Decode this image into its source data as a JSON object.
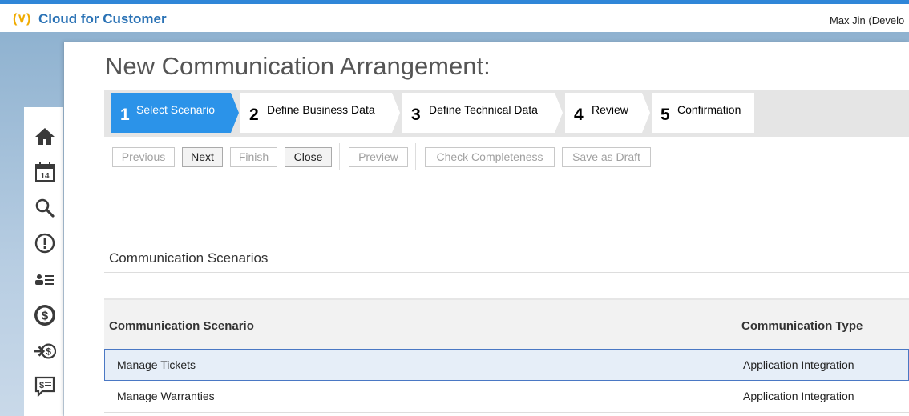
{
  "header": {
    "app_title": "Cloud for Customer",
    "user": "Max Jin (Develo",
    "logo_glyph": "(∨)"
  },
  "sidebar": {
    "items": [
      {
        "name": "home-icon"
      },
      {
        "name": "calendar-icon",
        "glyph": "14"
      },
      {
        "name": "search-icon"
      },
      {
        "name": "alert-icon"
      },
      {
        "name": "contacts-list-icon"
      },
      {
        "name": "dollar-icon"
      },
      {
        "name": "sales-transfer-icon"
      },
      {
        "name": "quote-icon"
      }
    ]
  },
  "page": {
    "title": "New Communication Arrangement:"
  },
  "steps": [
    {
      "num": "1",
      "label": "Select Scenario",
      "active": true
    },
    {
      "num": "2",
      "label": "Define Business Data",
      "active": false
    },
    {
      "num": "3",
      "label": "Define Technical Data",
      "active": false
    },
    {
      "num": "4",
      "label": "Review",
      "active": false
    },
    {
      "num": "5",
      "label": "Confirmation",
      "active": false
    }
  ],
  "toolbar": {
    "previous": "Previous",
    "next": "Next",
    "finish": "Finish",
    "close": "Close",
    "preview": "Preview",
    "check_completeness": "Check Completeness",
    "save_as_draft": "Save as Draft"
  },
  "section": {
    "title": "Communication Scenarios"
  },
  "table": {
    "columns": [
      "Communication Scenario",
      "Communication Type"
    ],
    "rows": [
      {
        "scenario": "Manage Tickets",
        "type": "Application Integration",
        "selected": true
      },
      {
        "scenario": "Manage Warranties",
        "type": "Application Integration",
        "selected": false
      }
    ]
  },
  "colors": {
    "accent": "#2b93e9",
    "brand_title": "#2a72b5",
    "logo": "#f0ab00"
  }
}
